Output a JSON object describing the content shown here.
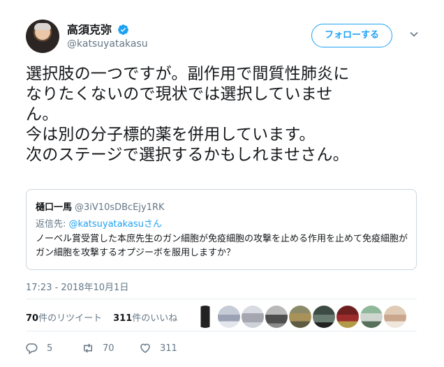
{
  "user": {
    "display_name": "高須克弥",
    "handle": "@katsuyatakasu"
  },
  "follow_button": "フォローする",
  "tweet": {
    "lines": [
      "選択肢の一つですが。副作用で間質性肺炎に",
      "なりたくないので現状では選択していませ",
      "ん。",
      "今は別の分子標的薬を併用しています。",
      "次のステージで選択するかもしれませさん。"
    ]
  },
  "quote": {
    "name": "樋口一馬",
    "handle": "@3iV10sDBcEjy1RK",
    "reply_prefix": "返信先: ",
    "reply_handle": "@katsuyatakasuさん",
    "text": "ノーベル賞受賞した本庶先生のガン細胞が免疫細胞の攻撃を止める作用を止めて免疫細胞がガン細胞を攻撃するオプジーボを服用しますか？"
  },
  "timestamp": "17:23 - 2018年10月1日",
  "stats": {
    "retweets_count": "70",
    "retweets_label": "件のリツイート",
    "likes_count": "311",
    "likes_label": "件のいいね"
  },
  "actions": {
    "replies": "5",
    "retweets": "70",
    "likes": "311"
  },
  "colors": {
    "accent": "#1da1f2",
    "secondary_text": "#657786",
    "border": "#e6ecf0"
  }
}
